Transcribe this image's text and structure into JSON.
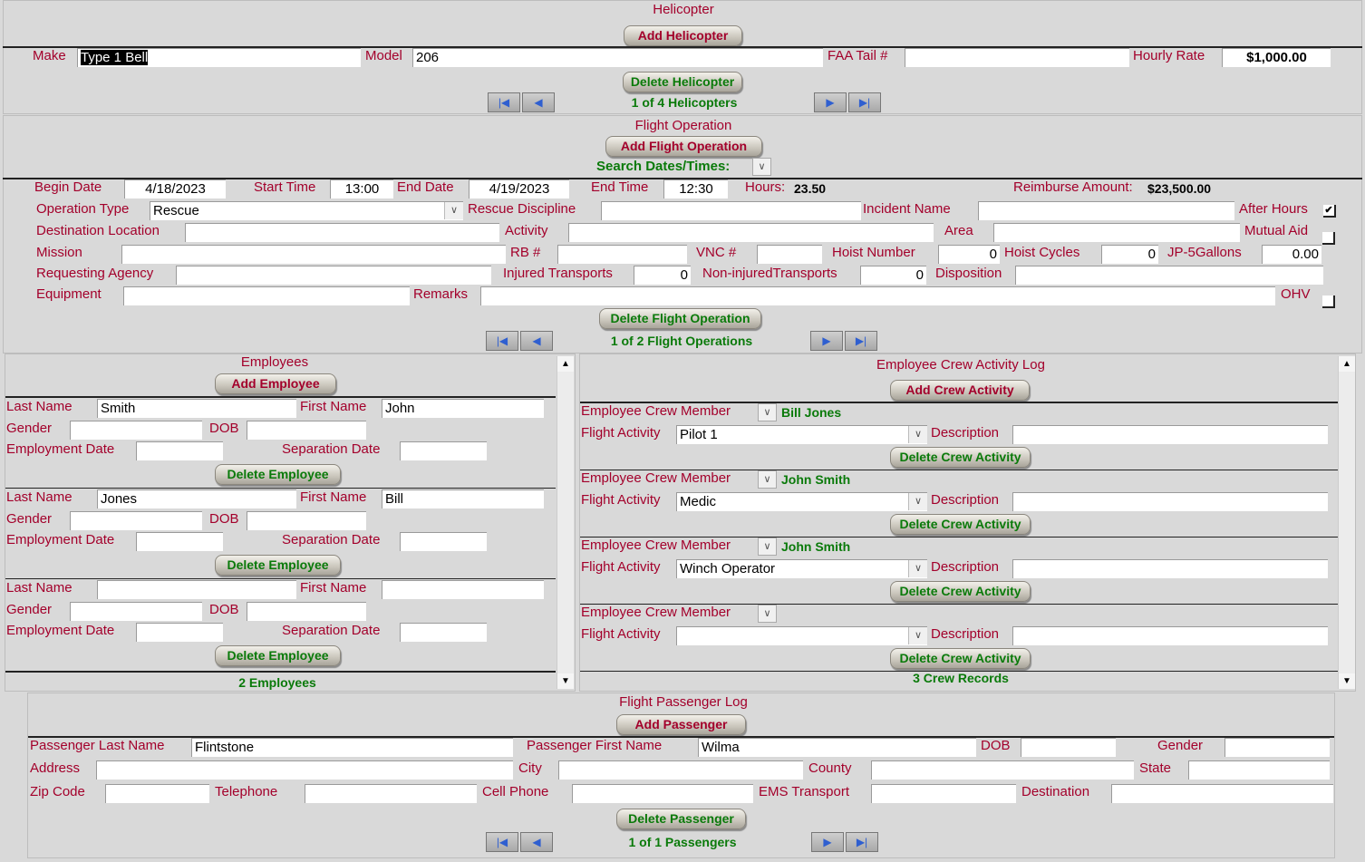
{
  "helicopter": {
    "title": "Helicopter",
    "add_label": "Add Helicopter",
    "delete_label": "Delete Helicopter",
    "record_text": "1 of 4 Helicopters",
    "make": {
      "label": "Make",
      "value": "Type 1 Bell"
    },
    "model": {
      "label": "Model",
      "value": "206"
    },
    "faa": {
      "label": "FAA Tail #",
      "value": ""
    },
    "rate": {
      "label": "Hourly Rate",
      "value": "$1,000.00"
    }
  },
  "flight": {
    "title": "Flight Operation",
    "add_label": "Add Flight Operation",
    "search_label": "Search Dates/Times:",
    "delete_label": "Delete Flight Operation",
    "record_text": "1 of 2 Flight Operations",
    "begin_date": {
      "label": "Begin Date",
      "value": "4/18/2023"
    },
    "start_time": {
      "label": "Start Time",
      "value": "13:00"
    },
    "end_date": {
      "label": "End Date",
      "value": "4/19/2023"
    },
    "end_time": {
      "label": "End Time",
      "value": "12:30"
    },
    "hours": {
      "label": "Hours:",
      "value": "23.50"
    },
    "reimburse": {
      "label": "Reimburse Amount:",
      "value": "$23,500.00"
    },
    "operation_type": {
      "label": "Operation Type",
      "value": "Rescue"
    },
    "rescue_discipline": {
      "label": "Rescue Discipline",
      "value": ""
    },
    "incident_name": {
      "label": "Incident Name",
      "value": ""
    },
    "after_hours": {
      "label": "After Hours",
      "checked": true
    },
    "destination_location": {
      "label": "Destination Location",
      "value": ""
    },
    "activity": {
      "label": "Activity",
      "value": ""
    },
    "area": {
      "label": "Area",
      "value": ""
    },
    "mutual_aid": {
      "label": "Mutual Aid",
      "checked": false
    },
    "mission": {
      "label": "Mission",
      "value": ""
    },
    "rb": {
      "label": "RB #",
      "value": ""
    },
    "vnc": {
      "label": "VNC #",
      "value": ""
    },
    "hoist_number": {
      "label": "Hoist Number",
      "value": "0"
    },
    "hoist_cycles": {
      "label": "Hoist Cycles",
      "value": "0"
    },
    "jp5": {
      "label": "JP-5Gallons",
      "value": "0.00"
    },
    "requesting_agency": {
      "label": "Requesting Agency",
      "value": ""
    },
    "injured": {
      "label": "Injured Transports",
      "value": "0"
    },
    "noninjured": {
      "label": "Non-injuredTransports",
      "value": "0"
    },
    "disposition": {
      "label": "Disposition",
      "value": ""
    },
    "equipment": {
      "label": "Equipment",
      "value": ""
    },
    "remarks": {
      "label": "Remarks",
      "value": ""
    },
    "ohv": {
      "label": "OHV",
      "checked": false
    }
  },
  "employees": {
    "title": "Employees",
    "add_label": "Add Employee",
    "delete_label": "Delete Employee",
    "count_text": "2 Employees",
    "labels": {
      "last": "Last Name",
      "first": "First Name",
      "gender": "Gender",
      "dob": "DOB",
      "employment": "Employment Date",
      "separation": "Separation Date"
    },
    "records": [
      {
        "last": "Smith",
        "first": "John",
        "gender": "",
        "dob": "",
        "employment": "",
        "separation": ""
      },
      {
        "last": "Jones",
        "first": "Bill",
        "gender": "",
        "dob": "",
        "employment": "",
        "separation": ""
      },
      {
        "last": "",
        "first": "",
        "gender": "",
        "dob": "",
        "employment": "",
        "separation": ""
      }
    ]
  },
  "crew": {
    "title": "Employee Crew Activity Log",
    "add_label": "Add Crew Activity",
    "delete_label": "Delete Crew Activity",
    "count_text": "3 Crew Records",
    "labels": {
      "member": "Employee Crew Member",
      "activity": "Flight Activity",
      "description": "Description"
    },
    "records": [
      {
        "member": "Bill Jones",
        "activity": "Pilot 1",
        "description": ""
      },
      {
        "member": "John Smith",
        "activity": "Medic",
        "description": ""
      },
      {
        "member": "John Smith",
        "activity": "Winch Operator",
        "description": ""
      },
      {
        "member": "",
        "activity": "",
        "description": ""
      }
    ]
  },
  "passenger": {
    "title": "Flight Passenger Log",
    "add_label": "Add Passenger",
    "delete_label": "Delete Passenger",
    "record_text": "1 of 1 Passengers",
    "last": {
      "label": "Passenger Last Name",
      "value": "Flintstone"
    },
    "first": {
      "label": "Passenger First Name",
      "value": "Wilma"
    },
    "dob": {
      "label": "DOB",
      "value": ""
    },
    "gender": {
      "label": "Gender",
      "value": ""
    },
    "address": {
      "label": "Address",
      "value": ""
    },
    "city": {
      "label": "City",
      "value": ""
    },
    "county": {
      "label": "County",
      "value": ""
    },
    "state": {
      "label": "State",
      "value": ""
    },
    "zip": {
      "label": "Zip Code",
      "value": ""
    },
    "telephone": {
      "label": "Telephone",
      "value": ""
    },
    "cell": {
      "label": "Cell Phone",
      "value": ""
    },
    "ems": {
      "label": "EMS Transport",
      "value": ""
    },
    "destination": {
      "label": "Destination",
      "value": ""
    }
  },
  "icons": {
    "first": "first-record-icon",
    "prev": "prev-record-icon",
    "next": "next-record-icon",
    "last": "last-record-icon",
    "dropdown": "chevron-down-icon",
    "check": "checkmark-icon"
  },
  "colors": {
    "label": "#a3002b",
    "green": "#0a7a0a",
    "background": "#d9d9d9"
  }
}
